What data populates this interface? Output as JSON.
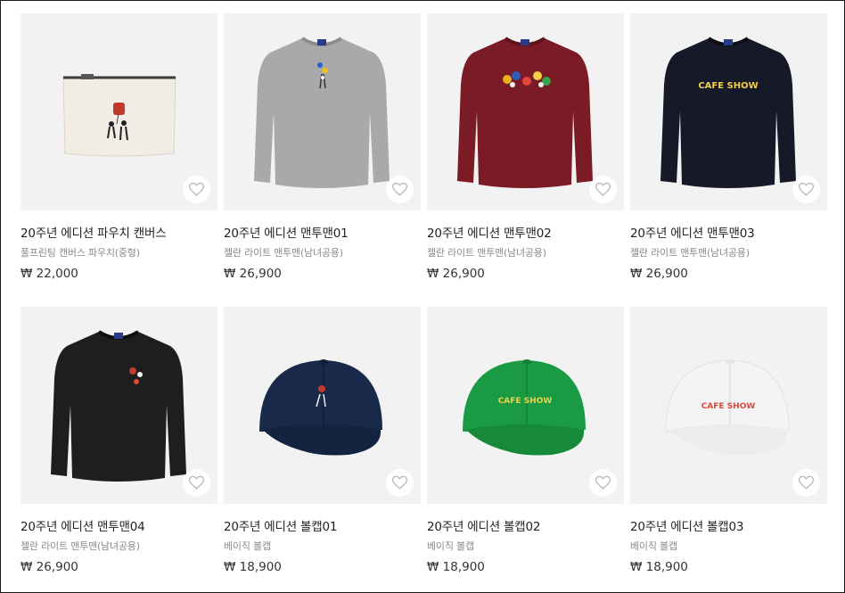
{
  "products": [
    {
      "title": "20주년 에디션 파우치 캔버스",
      "subtitle": "풀프린팅 캔버스 파우치(중형)",
      "price": "₩ 22,000",
      "image": "canvas-pouch",
      "color": "#f1ede4"
    },
    {
      "title": "20주년 에디션 맨투맨01",
      "subtitle": "젤란 라이트 맨투맨(남녀공용)",
      "price": "₩ 26,900",
      "image": "sweatshirt",
      "color": "#a9a9ab"
    },
    {
      "title": "20주년 에디션 맨투맨02",
      "subtitle": "젤란 라이트 맨투맨(남녀공용)",
      "price": "₩ 26,900",
      "image": "sweatshirt",
      "color": "#7a1b25"
    },
    {
      "title": "20주년 에디션 맨투맨03",
      "subtitle": "젤란 라이트 맨투맨(남녀공용)",
      "price": "₩ 26,900",
      "image": "sweatshirt",
      "color": "#161a28"
    },
    {
      "title": "20주년 에디션 맨투맨04",
      "subtitle": "젤란 라이트 맨투맨(남녀공용)",
      "price": "₩ 26,900",
      "image": "sweatshirt",
      "color": "#1e1e1e"
    },
    {
      "title": "20주년 에디션 볼캡01",
      "subtitle": "베이직 볼캡",
      "price": "₩ 18,900",
      "image": "ball-cap",
      "color": "#18294a"
    },
    {
      "title": "20주년 에디션 볼캡02",
      "subtitle": "베이직 볼캡",
      "price": "₩ 18,900",
      "image": "ball-cap",
      "color": "#1a9b43"
    },
    {
      "title": "20주년 에디션 볼캡03",
      "subtitle": "베이직 볼캡",
      "price": "₩ 18,900",
      "image": "ball-cap",
      "color": "#f4f4f4"
    }
  ],
  "print_logo": "CAFE SHOW",
  "icons": {
    "wishlist": "heart-outline-icon"
  }
}
